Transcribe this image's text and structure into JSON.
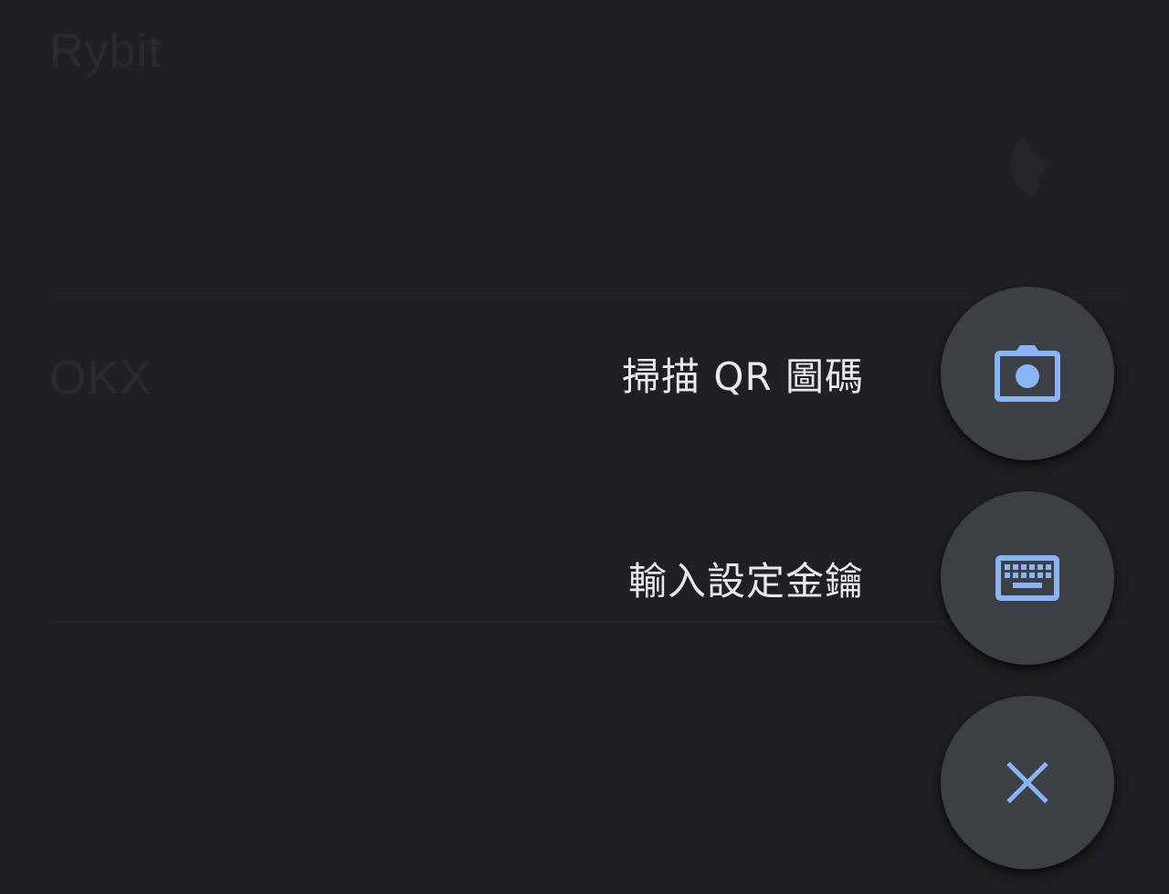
{
  "accounts": [
    {
      "name": "Rybit"
    },
    {
      "name": "OKX"
    }
  ],
  "speed_dial": {
    "scan_label": "掃描 QR 圖碼",
    "manual_label": "輸入設定金鑰",
    "scan_icon": "camera-icon",
    "manual_icon": "keyboard-icon",
    "close_icon": "close-icon"
  },
  "colors": {
    "background": "#1f2023",
    "fab_background": "#3c3f43",
    "icon_accent": "#8ab4f8",
    "label_text": "#e8eaed"
  }
}
